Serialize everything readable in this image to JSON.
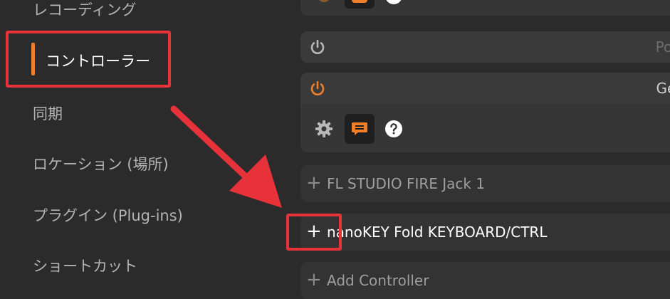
{
  "sidebar": {
    "items": [
      {
        "label": "レコーディング"
      },
      {
        "label": "コントローラー"
      },
      {
        "label": "同期"
      },
      {
        "label": "ロケーション (場所)"
      },
      {
        "label": "プラグイン (Plug-ins)"
      },
      {
        "label": "ショートカット"
      }
    ],
    "active_index": 1
  },
  "controllers": {
    "panels": [
      {
        "name": "Pola",
        "power": "off"
      },
      {
        "name": "Gen",
        "power": "on"
      }
    ],
    "rows": [
      {
        "label": "FL STUDIO FIRE Jack 1"
      },
      {
        "label": "nanoKEY Fold KEYBOARD/CTRL"
      },
      {
        "label": "Add Controller"
      }
    ],
    "plus_icon": "+"
  },
  "colors": {
    "accent": "#f07f2b",
    "annotation": "#e8323a"
  }
}
